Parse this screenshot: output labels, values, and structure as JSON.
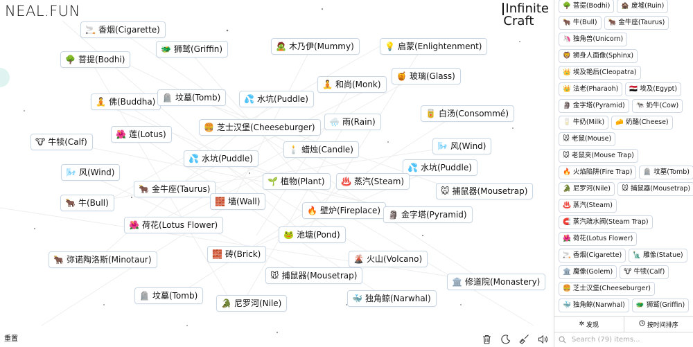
{
  "logo": "NEAL.FUN",
  "brand": {
    "line1": "Infinite",
    "line2": "Craft"
  },
  "canvas_items": [
    {
      "emoji": "🚬",
      "label": "香烟(Cigarette)"
    },
    {
      "emoji": "🐲",
      "label": "狮鹫(Griffin)"
    },
    {
      "emoji": "🧟",
      "label": "木乃伊(Mummy)"
    },
    {
      "emoji": "💡",
      "label": "启蒙(Enlightenment)"
    },
    {
      "emoji": "🌳",
      "label": "菩提(Bodhi)"
    },
    {
      "emoji": "🍯",
      "label": "玻璃(Glass)"
    },
    {
      "emoji": "🧘",
      "label": "和尚(Monk)"
    },
    {
      "emoji": "🧘",
      "label": "佛(Buddha)"
    },
    {
      "emoji": "🪦",
      "label": "坟墓(Tomb)"
    },
    {
      "emoji": "💦",
      "label": "水坑(Puddle)"
    },
    {
      "emoji": "🥫",
      "label": "白汤(Consommé)"
    },
    {
      "emoji": "🌧️",
      "label": "雨(Rain)"
    },
    {
      "emoji": "🍔",
      "label": "芝士汉堡(Cheeseburger)"
    },
    {
      "emoji": "🌺",
      "label": "莲(Lotus)"
    },
    {
      "emoji": "🐮",
      "label": "牛犊(Calf)"
    },
    {
      "emoji": "🌬️",
      "label": "风(Wind)"
    },
    {
      "emoji": "🕯️",
      "label": "蜡烛(Candle)"
    },
    {
      "emoji": "💦",
      "label": "水坑(Puddle)"
    },
    {
      "emoji": "💦",
      "label": "水坑(Puddle)"
    },
    {
      "emoji": "🌬️",
      "label": "风(Wind)"
    },
    {
      "emoji": "🌱",
      "label": "植物(Plant)"
    },
    {
      "emoji": "♨️",
      "label": "蒸汽(Steam)"
    },
    {
      "emoji": "🐂",
      "label": "金牛座(Taurus)"
    },
    {
      "emoji": "🐭",
      "label": "捕鼠器(Mousetrap)"
    },
    {
      "emoji": "🐂",
      "label": "牛(Bull)"
    },
    {
      "emoji": "🧱",
      "label": "墙(Wall)"
    },
    {
      "emoji": "🔥",
      "label": "壁炉(Fireplace)"
    },
    {
      "emoji": "🗿",
      "label": "金字塔(Pyramid)"
    },
    {
      "emoji": "🌺",
      "label": "荷花(Lotus Flower)"
    },
    {
      "emoji": "🐸",
      "label": "池塘(Pond)"
    },
    {
      "emoji": "🧱",
      "label": "砖(Brick)"
    },
    {
      "emoji": "🐂",
      "label": "弥诺陶洛斯(Minotaur)"
    },
    {
      "emoji": "🌋",
      "label": "火山(Volcano)"
    },
    {
      "emoji": "🐭",
      "label": "捕鼠器(Mousetrap)"
    },
    {
      "emoji": "🏛️",
      "label": "修道院(Monastery)"
    },
    {
      "emoji": "🪦",
      "label": "坟墓(Tomb)"
    },
    {
      "emoji": "🐳",
      "label": "独角鲸(Narwhal)"
    },
    {
      "emoji": "🐊",
      "label": "尼罗河(Nile)"
    }
  ],
  "reset_label": "重置",
  "tools": [
    "trash-icon",
    "moon-icon",
    "broom-icon",
    "sound-icon"
  ],
  "sidebar": {
    "rows": [
      [
        {
          "emoji": "🌳",
          "label": "菩提(Bodhi)"
        },
        {
          "emoji": "🏚️",
          "label": "废墟(Ruin)"
        }
      ],
      [
        {
          "emoji": "🐂",
          "label": "牛(Bull)"
        },
        {
          "emoji": "🐂",
          "label": "金牛座(Taurus)"
        }
      ],
      [
        {
          "emoji": "🦄",
          "label": "独角兽(Unicorn)"
        }
      ],
      [
        {
          "emoji": "🦁",
          "label": "狮身人面像(Sphinx)"
        }
      ],
      [
        {
          "emoji": "👑",
          "label": "埃及艳后(Cleopatra)"
        }
      ],
      [
        {
          "emoji": "👑",
          "label": "法老(Pharaoh)"
        },
        {
          "emoji": "🇪🇬",
          "label": "埃及(Egypt)"
        }
      ],
      [
        {
          "emoji": "🗿",
          "label": "金字塔(Pyramid)"
        },
        {
          "emoji": "🐄",
          "label": "奶牛(Cow)"
        }
      ],
      [
        {
          "emoji": "🥛",
          "label": "牛奶(Milk)"
        },
        {
          "emoji": "🧀",
          "label": "奶酪(Cheese)"
        }
      ],
      [
        {
          "emoji": "🐭",
          "label": "老鼠(Mouse)"
        }
      ],
      [
        {
          "emoji": "🐭",
          "label": "老鼠夹(Mouse Trap)"
        }
      ],
      [
        {
          "emoji": "🔥",
          "label": "火焰陷阱(Fire Trap)"
        },
        {
          "emoji": "🪦",
          "label": "坟墓(Tomb)"
        }
      ],
      [
        {
          "emoji": "🐊",
          "label": "尼罗河(Nile)"
        },
        {
          "emoji": "🐭",
          "label": "捕鼠器(Mousetrap)"
        }
      ],
      [
        {
          "emoji": "♨️",
          "label": "蒸汽(Steam)"
        }
      ],
      [
        {
          "emoji": "🧲",
          "label": "蒸汽疏水阀(Steam Trap)"
        }
      ],
      [
        {
          "emoji": "🌺",
          "label": "荷花(Lotus Flower)"
        }
      ],
      [
        {
          "emoji": "🚬",
          "label": "香烟(Cigarette)"
        },
        {
          "emoji": "🗽",
          "label": "雕像(Statue)"
        }
      ],
      [
        {
          "emoji": "🏛️",
          "label": "魔像(Golem)"
        },
        {
          "emoji": "🐮",
          "label": "牛犊(Calf)"
        }
      ],
      [
        {
          "emoji": "🍔",
          "label": "芝士汉堡(Cheeseburger)"
        }
      ],
      [
        {
          "emoji": "🐳",
          "label": "独角鲸(Narwhal)"
        },
        {
          "emoji": "🐲",
          "label": "狮鹫(Griffin)"
        }
      ]
    ],
    "tab_discover": "发现",
    "tab_sort": "按时间排序",
    "search_placeholder": "Search (79) items..."
  }
}
